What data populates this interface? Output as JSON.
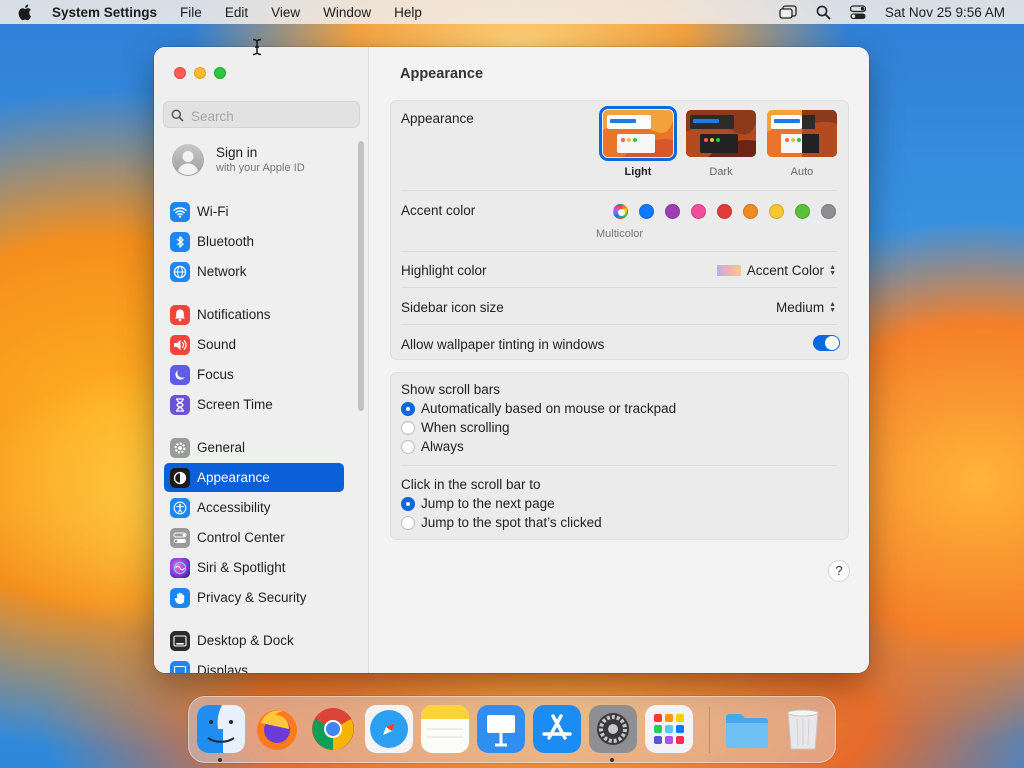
{
  "menubar": {
    "apple_icon": "apple-logo-icon",
    "app_name": "System Settings",
    "menus": [
      "File",
      "Edit",
      "View",
      "Window",
      "Help"
    ],
    "status_icons": [
      "window-stack-icon",
      "spotlight-search-icon",
      "control-center-icon"
    ],
    "clock": "Sat Nov 25  9:56 AM"
  },
  "sidebar": {
    "search_placeholder": "Search",
    "account": {
      "title": "Sign in",
      "subtitle": "with your Apple ID"
    },
    "items": [
      {
        "label": "Wi-Fi",
        "icon": "wifi-icon",
        "color": "#1e86f0"
      },
      {
        "label": "Bluetooth",
        "icon": "bluetooth-icon",
        "color": "#1e86f0"
      },
      {
        "label": "Network",
        "icon": "globe-icon",
        "color": "#1e86f0"
      },
      {
        "label": "Notifications",
        "icon": "bell-icon",
        "color": "#f0463c"
      },
      {
        "label": "Sound",
        "icon": "speaker-icon",
        "color": "#f0463c"
      },
      {
        "label": "Focus",
        "icon": "moon-icon",
        "color": "#5e5ce6"
      },
      {
        "label": "Screen Time",
        "icon": "hourglass-icon",
        "color": "#6a53d6"
      },
      {
        "label": "General",
        "icon": "gear-icon",
        "color": "#9a9a9a"
      },
      {
        "label": "Appearance",
        "icon": "appearance-icon",
        "color": "#1c1c1c",
        "selected": true
      },
      {
        "label": "Accessibility",
        "icon": "accessibility-icon",
        "color": "#1e86f0"
      },
      {
        "label": "Control Center",
        "icon": "control-center-icon",
        "color": "#9a9a9a"
      },
      {
        "label": "Siri & Spotlight",
        "icon": "siri-icon",
        "color": "#c040c8"
      },
      {
        "label": "Privacy & Security",
        "icon": "hand-icon",
        "color": "#1e86f0"
      },
      {
        "label": "Desktop & Dock",
        "icon": "dock-icon",
        "color": "#2a2a2a"
      },
      {
        "label": "Displays",
        "icon": "display-icon",
        "color": "#1e86f0"
      }
    ]
  },
  "main": {
    "title": "Appearance",
    "appearance": {
      "label": "Appearance",
      "options": [
        {
          "label": "Light",
          "selected": true
        },
        {
          "label": "Dark",
          "selected": false
        },
        {
          "label": "Auto",
          "selected": false
        }
      ]
    },
    "accent": {
      "label": "Accent color",
      "selected_name": "Multicolor",
      "colors": [
        "#bf5af2",
        "#0a7aff",
        "#9b3fb5",
        "#f04d9c",
        "#e23a3a",
        "#f08a1c",
        "#f7c631",
        "#5ac13b",
        "#8e8e93"
      ]
    },
    "highlight": {
      "label": "Highlight color",
      "value": "Accent Color"
    },
    "sidebar_icon_size": {
      "label": "Sidebar icon size",
      "value": "Medium"
    },
    "wallpaper_tinting": {
      "label": "Allow wallpaper tinting in windows",
      "on": true
    },
    "scroll_bars": {
      "label": "Show scroll bars",
      "options": [
        {
          "label": "Automatically based on mouse or trackpad",
          "selected": true
        },
        {
          "label": "When scrolling",
          "selected": false
        },
        {
          "label": "Always",
          "selected": false
        }
      ]
    },
    "click_scroll": {
      "label": "Click in the scroll bar to",
      "options": [
        {
          "label": "Jump to the next page",
          "selected": true
        },
        {
          "label": "Jump to the spot that’s clicked",
          "selected": false
        }
      ]
    },
    "help": "?"
  },
  "dock": {
    "apps": [
      {
        "name": "Finder",
        "icon": "finder-icon",
        "running": true
      },
      {
        "name": "Firefox",
        "icon": "firefox-icon",
        "running": false
      },
      {
        "name": "Chrome",
        "icon": "chrome-icon",
        "running": false
      },
      {
        "name": "Safari",
        "icon": "safari-icon",
        "running": false
      },
      {
        "name": "Notes",
        "icon": "notes-icon",
        "running": false
      },
      {
        "name": "Keynote",
        "icon": "keynote-icon",
        "running": false
      },
      {
        "name": "App Store",
        "icon": "app-store-icon",
        "running": false
      },
      {
        "name": "System Settings",
        "icon": "system-settings-icon",
        "running": true
      },
      {
        "name": "Launchpad",
        "icon": "launchpad-icon",
        "running": false
      },
      {
        "name": "Downloads",
        "icon": "folder-icon",
        "running": false
      },
      {
        "name": "Trash",
        "icon": "trash-icon",
        "running": false
      }
    ]
  }
}
